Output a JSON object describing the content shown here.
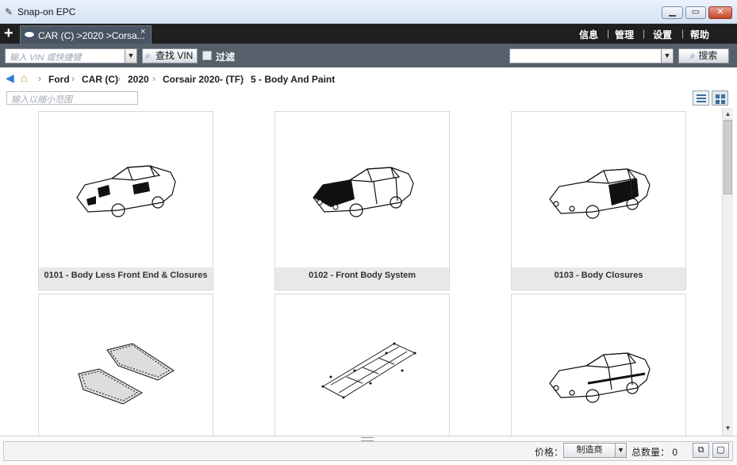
{
  "window": {
    "title": "Snap-on EPC",
    "minimize": "▁",
    "maximize": "▭",
    "close": "✕"
  },
  "tabs": {
    "add": "+",
    "items": [
      {
        "label": "CAR (C) >2020 >Corsa...",
        "close": "×"
      }
    ]
  },
  "top_menu": [
    "信息",
    "管理",
    "设置",
    "帮助"
  ],
  "search": {
    "vin_placeholder": "输入 VIN 或快捷键",
    "vin_button": "查找 VIN",
    "filter_label": "过滤",
    "right_value": "",
    "search_button": "搜索"
  },
  "breadcrumb": [
    "Ford",
    "CAR (C)",
    "2020",
    "Corsair 2020- (TF)",
    "5 - Body And Paint"
  ],
  "narrow": {
    "placeholder": "输入以缩小范围"
  },
  "cards": [
    {
      "caption": "0101 - Body Less Front End & Closures",
      "illustration": "car-body-shell-icon"
    },
    {
      "caption": "0102 - Front Body System",
      "illustration": "car-front-highlight-icon"
    },
    {
      "caption": "0103 - Body Closures",
      "illustration": "car-doors-highlight-icon"
    },
    {
      "caption": "",
      "illustration": "floor-mats-icon"
    },
    {
      "caption": "",
      "illustration": "underbody-frame-icon"
    },
    {
      "caption": "",
      "illustration": "car-side-molding-icon"
    }
  ],
  "status": {
    "price_label": "价格：",
    "price_source": "制造商",
    "total_label": "总数量：",
    "total_value": "0"
  }
}
